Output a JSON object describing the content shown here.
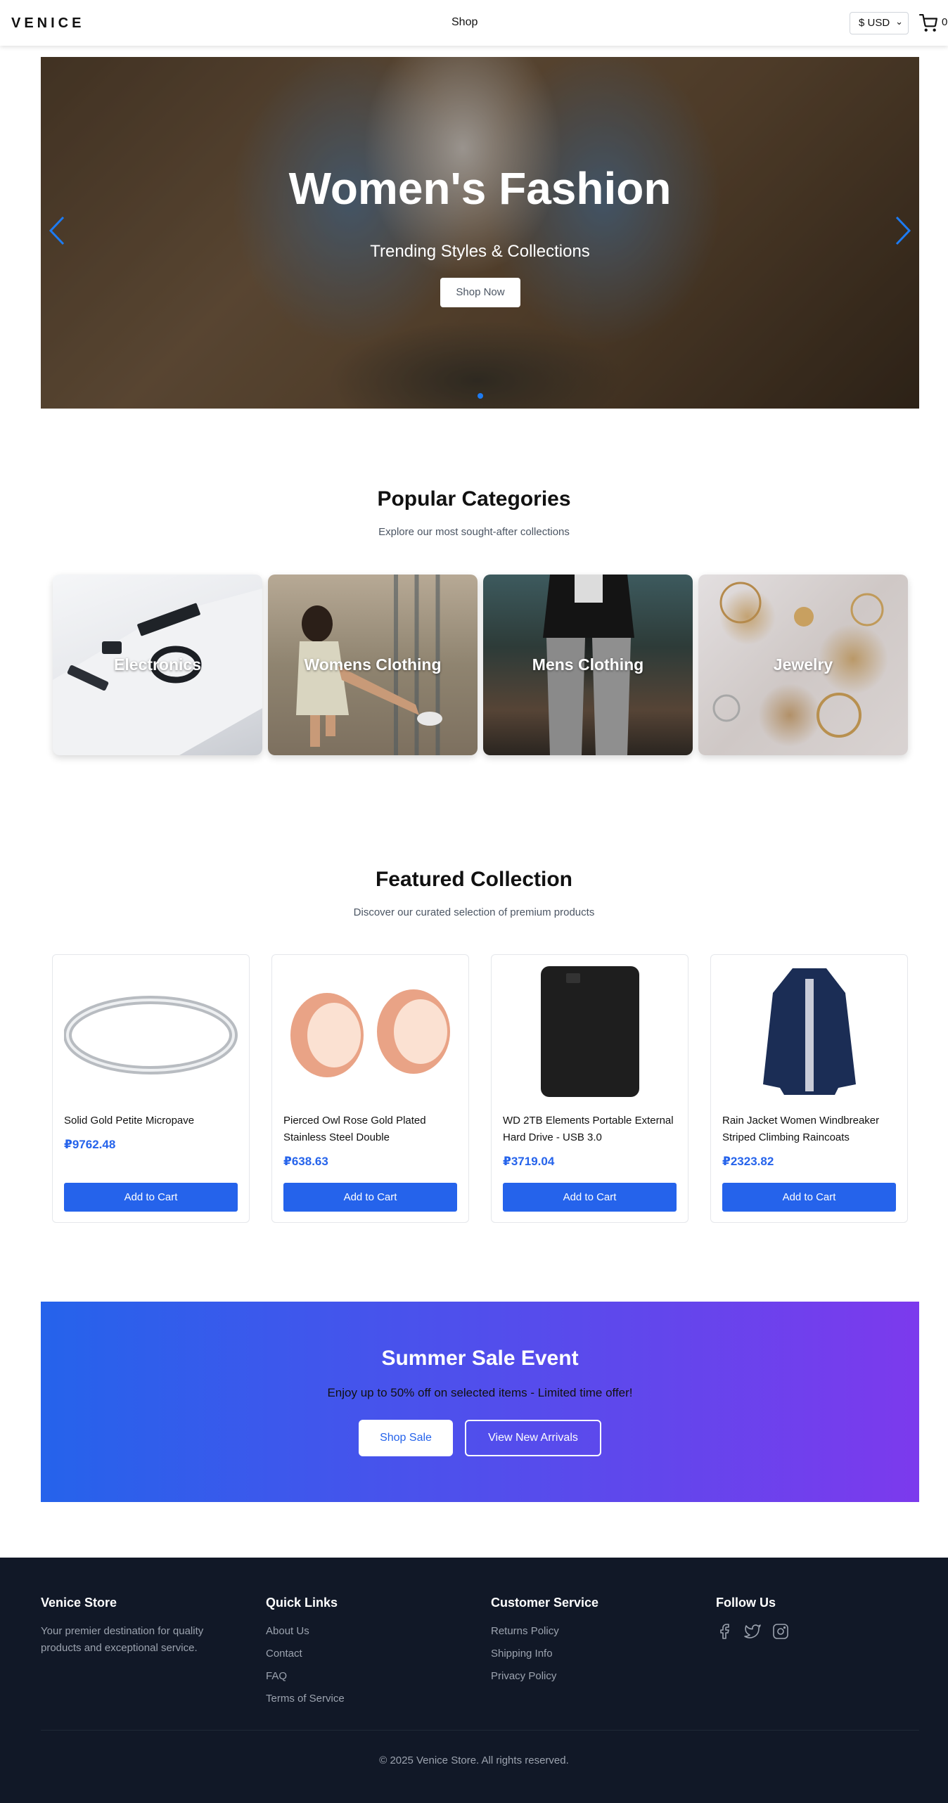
{
  "header": {
    "logo": "VENICE",
    "nav_shop": "Shop",
    "currency": "$ USD",
    "cart_count": "0"
  },
  "hero": {
    "title": "Women's Fashion",
    "subtitle": "Trending Styles & Collections",
    "button": "Shop Now"
  },
  "categories": {
    "title": "Popular Categories",
    "subtitle": "Explore our most sought-after collections",
    "items": [
      {
        "label": "Electronics"
      },
      {
        "label": "Womens Clothing"
      },
      {
        "label": "Mens Clothing"
      },
      {
        "label": "Jewelry"
      }
    ]
  },
  "featured": {
    "title": "Featured Collection",
    "subtitle": "Discover our curated selection of premium products",
    "add_label": "Add to Cart",
    "products": [
      {
        "name": "Solid Gold Petite Micropave",
        "price": "₽9762.48"
      },
      {
        "name": "Pierced Owl Rose Gold Plated Stainless Steel Double",
        "price": "₽638.63"
      },
      {
        "name": "WD 2TB Elements Portable External Hard Drive - USB 3.0",
        "price": "₽3719.04"
      },
      {
        "name": "Rain Jacket Women Windbreaker Striped Climbing Raincoats",
        "price": "₽2323.82"
      }
    ]
  },
  "sale": {
    "title": "Summer Sale Event",
    "subtitle": "Enjoy up to 50% off on selected items - Limited time offer!",
    "primary_button": "Shop Sale",
    "secondary_button": "View New Arrivals"
  },
  "footer": {
    "brand": {
      "title": "Venice Store",
      "text": "Your premier destination for quality products and exceptional service."
    },
    "quick_links": {
      "title": "Quick Links",
      "links": [
        "About Us",
        "Contact",
        "FAQ",
        "Terms of Service"
      ]
    },
    "customer_service": {
      "title": "Customer Service",
      "links": [
        "Returns Policy",
        "Shipping Info",
        "Privacy Policy"
      ]
    },
    "follow": {
      "title": "Follow Us",
      "icons": [
        "facebook-icon",
        "twitter-icon",
        "instagram-icon"
      ]
    },
    "copyright": "© 2025 Venice Store. All rights reserved."
  },
  "colors": {
    "accent": "#2563eb",
    "gradient_end": "#7c3aed",
    "footer_bg": "#111827"
  }
}
